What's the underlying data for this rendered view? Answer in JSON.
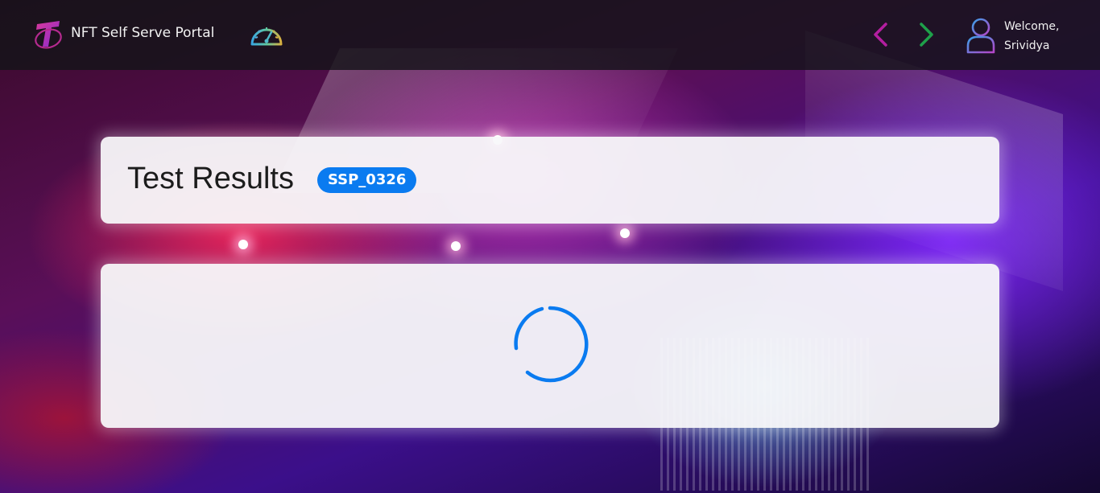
{
  "header": {
    "app_title": "NFT Self Serve Portal",
    "welcome_line1": "Welcome,",
    "welcome_line2": "Srividya",
    "icons": {
      "logo": "telstra-logo-icon",
      "dashboard": "speedometer-icon",
      "back": "chevron-left-icon",
      "forward": "chevron-right-icon",
      "user": "user-icon"
    }
  },
  "main": {
    "title": "Test Results",
    "test_id": "SSP_0326",
    "loading_indicator": "loading-spinner-icon"
  },
  "colors": {
    "accent_blue": "#0a7bf0",
    "back_arrow": "#b41ea0",
    "forward_arrow": "#1ea04a",
    "header_bg": "#141418"
  }
}
